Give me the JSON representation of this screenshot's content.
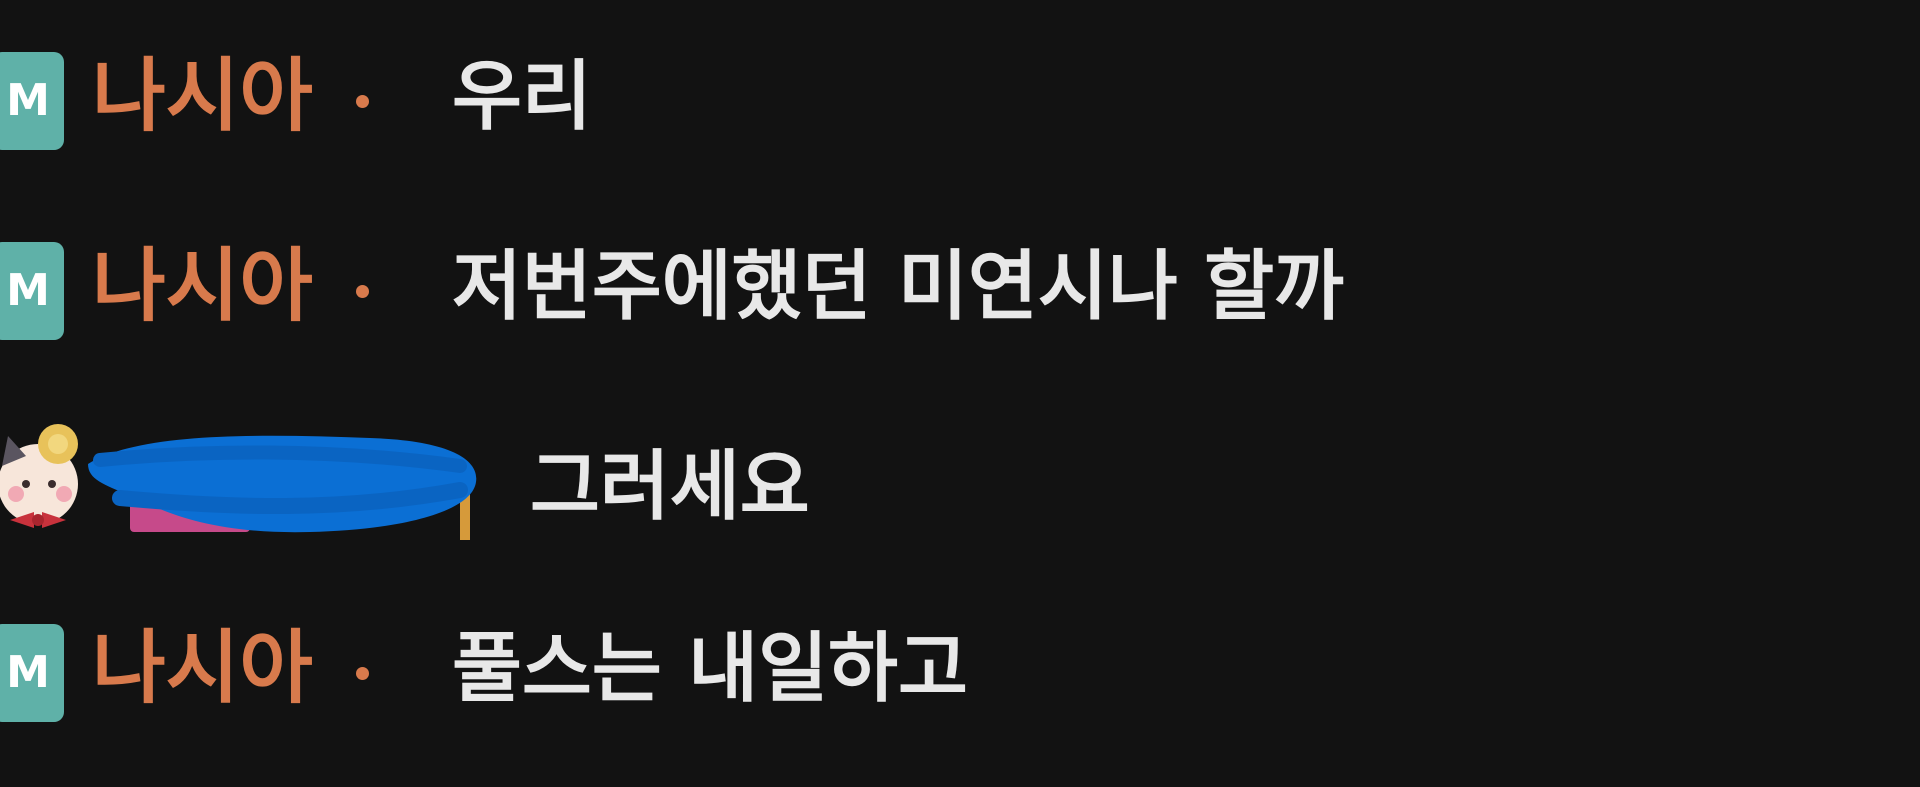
{
  "chat": {
    "messages": [
      {
        "badge": "M",
        "nickname": "나시아",
        "text": "우리"
      },
      {
        "badge": "M",
        "nickname": "나시아",
        "text": "저번주에했던 미연시나 할까"
      },
      {
        "avatar": "character-avatar-icon",
        "nickname_redacted": true,
        "text": "그러세요"
      },
      {
        "badge": "M",
        "nickname": "나시아",
        "text": "풀스는 내일하고"
      }
    ]
  },
  "colors": {
    "background": "#121212",
    "nickname": "#d87a4c",
    "message": "#e8e8e8",
    "badge": "#5fb1a8",
    "redaction": "#0b6fd4"
  }
}
